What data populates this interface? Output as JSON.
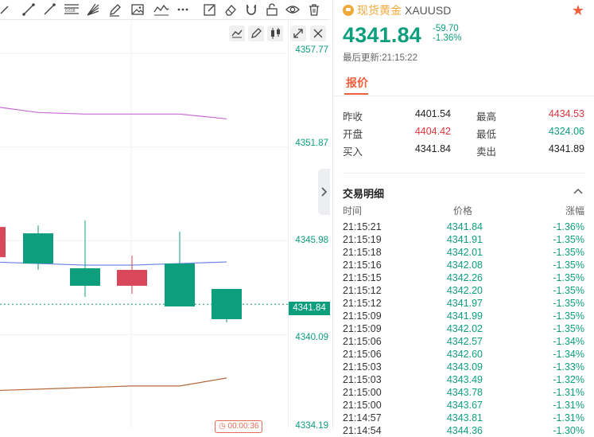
{
  "toolbar": {
    "icons": [
      "horizontal-line-icon",
      "ray-line-icon",
      "trend-line-icon",
      "fibonacci-icon",
      "fan-icon",
      "pencil-icon",
      "image-icon",
      "wave-icon",
      "more-icon",
      "note-icon",
      "eraser-icon",
      "magnet-icon",
      "lock-icon",
      "eye-icon",
      "trash-icon"
    ],
    "fib_label": "0.618"
  },
  "chart": {
    "y_ticks": [
      "4357.77",
      "4351.87",
      "4345.98",
      "4340.09",
      "4334.19"
    ],
    "current_price_tag": "4341.84",
    "countdown": "00:00:36",
    "colors": {
      "up": "#0d9e7e",
      "down": "#d8475a",
      "ma_purple": "#c86bd4",
      "ma_blue": "#6a7fe0",
      "ma_brown": "#b5683a"
    }
  },
  "chart_data": {
    "type": "candlestick",
    "y_range": [
      4334.19,
      4357.77
    ],
    "current_price": 4341.84,
    "candles": [
      {
        "open": 4344.8,
        "close": 4346.7,
        "high": 4346.7,
        "low": 4344.8,
        "color": "down"
      },
      {
        "open": 4346.3,
        "close": 4344.4,
        "high": 4346.8,
        "low": 4344.0,
        "color": "up"
      },
      {
        "open": 4344.1,
        "close": 4343.0,
        "high": 4347.1,
        "low": 4342.3,
        "color": "up"
      },
      {
        "open": 4343.0,
        "close": 4344.0,
        "high": 4344.9,
        "low": 4342.5,
        "color": "down"
      },
      {
        "open": 4344.4,
        "close": 4341.7,
        "high": 4346.4,
        "low": 4341.7,
        "color": "up"
      },
      {
        "open": 4342.8,
        "close": 4340.9,
        "high": 4342.8,
        "low": 4340.7,
        "color": "up"
      }
    ],
    "ma_purple": [
      4354.3,
      4353.9,
      4353.8,
      4353.8,
      4353.8,
      4353.5
    ],
    "ma_blue": [
      4344.5,
      4344.4,
      4344.3,
      4344.3,
      4344.4,
      4344.5
    ],
    "ma_brown": [
      4336.4,
      4336.5,
      4336.6,
      4336.7,
      4336.7,
      4337.2
    ]
  },
  "panel": {
    "name": "现货黄金",
    "code": "XAUUSD",
    "price": "4341.84",
    "change": "-59.70",
    "change_pct": "-1.36%",
    "updated": "最后更新:21:15:22",
    "tab": "报价",
    "quotes": {
      "prev_close_label": "昨收",
      "prev_close": "4401.54",
      "open_label": "开盘",
      "open": "4404.42",
      "bid_label": "买入",
      "bid": "4341.84",
      "high_label": "最高",
      "high": "4434.53",
      "low_label": "最低",
      "low": "4324.06",
      "ask_label": "卖出",
      "ask": "4341.89"
    },
    "trades_title": "交易明细",
    "trade_headers": [
      "时间",
      "价格",
      "涨幅"
    ],
    "trades": [
      {
        "time": "21:15:21",
        "price": "4341.84",
        "chg": "-1.36%"
      },
      {
        "time": "21:15:19",
        "price": "4341.91",
        "chg": "-1.35%"
      },
      {
        "time": "21:15:18",
        "price": "4342.01",
        "chg": "-1.35%"
      },
      {
        "time": "21:15:16",
        "price": "4342.08",
        "chg": "-1.35%"
      },
      {
        "time": "21:15:15",
        "price": "4342.26",
        "chg": "-1.35%"
      },
      {
        "time": "21:15:12",
        "price": "4342.20",
        "chg": "-1.35%"
      },
      {
        "time": "21:15:12",
        "price": "4341.97",
        "chg": "-1.35%"
      },
      {
        "time": "21:15:09",
        "price": "4341.99",
        "chg": "-1.35%"
      },
      {
        "time": "21:15:09",
        "price": "4342.02",
        "chg": "-1.35%"
      },
      {
        "time": "21:15:06",
        "price": "4342.57",
        "chg": "-1.34%"
      },
      {
        "time": "21:15:06",
        "price": "4342.60",
        "chg": "-1.34%"
      },
      {
        "time": "21:15:03",
        "price": "4343.09",
        "chg": "-1.33%"
      },
      {
        "time": "21:15:03",
        "price": "4343.49",
        "chg": "-1.32%"
      },
      {
        "time": "21:15:00",
        "price": "4343.78",
        "chg": "-1.31%"
      },
      {
        "time": "21:15:00",
        "price": "4343.67",
        "chg": "-1.31%"
      },
      {
        "time": "21:14:57",
        "price": "4343.81",
        "chg": "-1.31%"
      },
      {
        "time": "21:14:54",
        "price": "4344.36",
        "chg": "-1.30%"
      }
    ]
  }
}
